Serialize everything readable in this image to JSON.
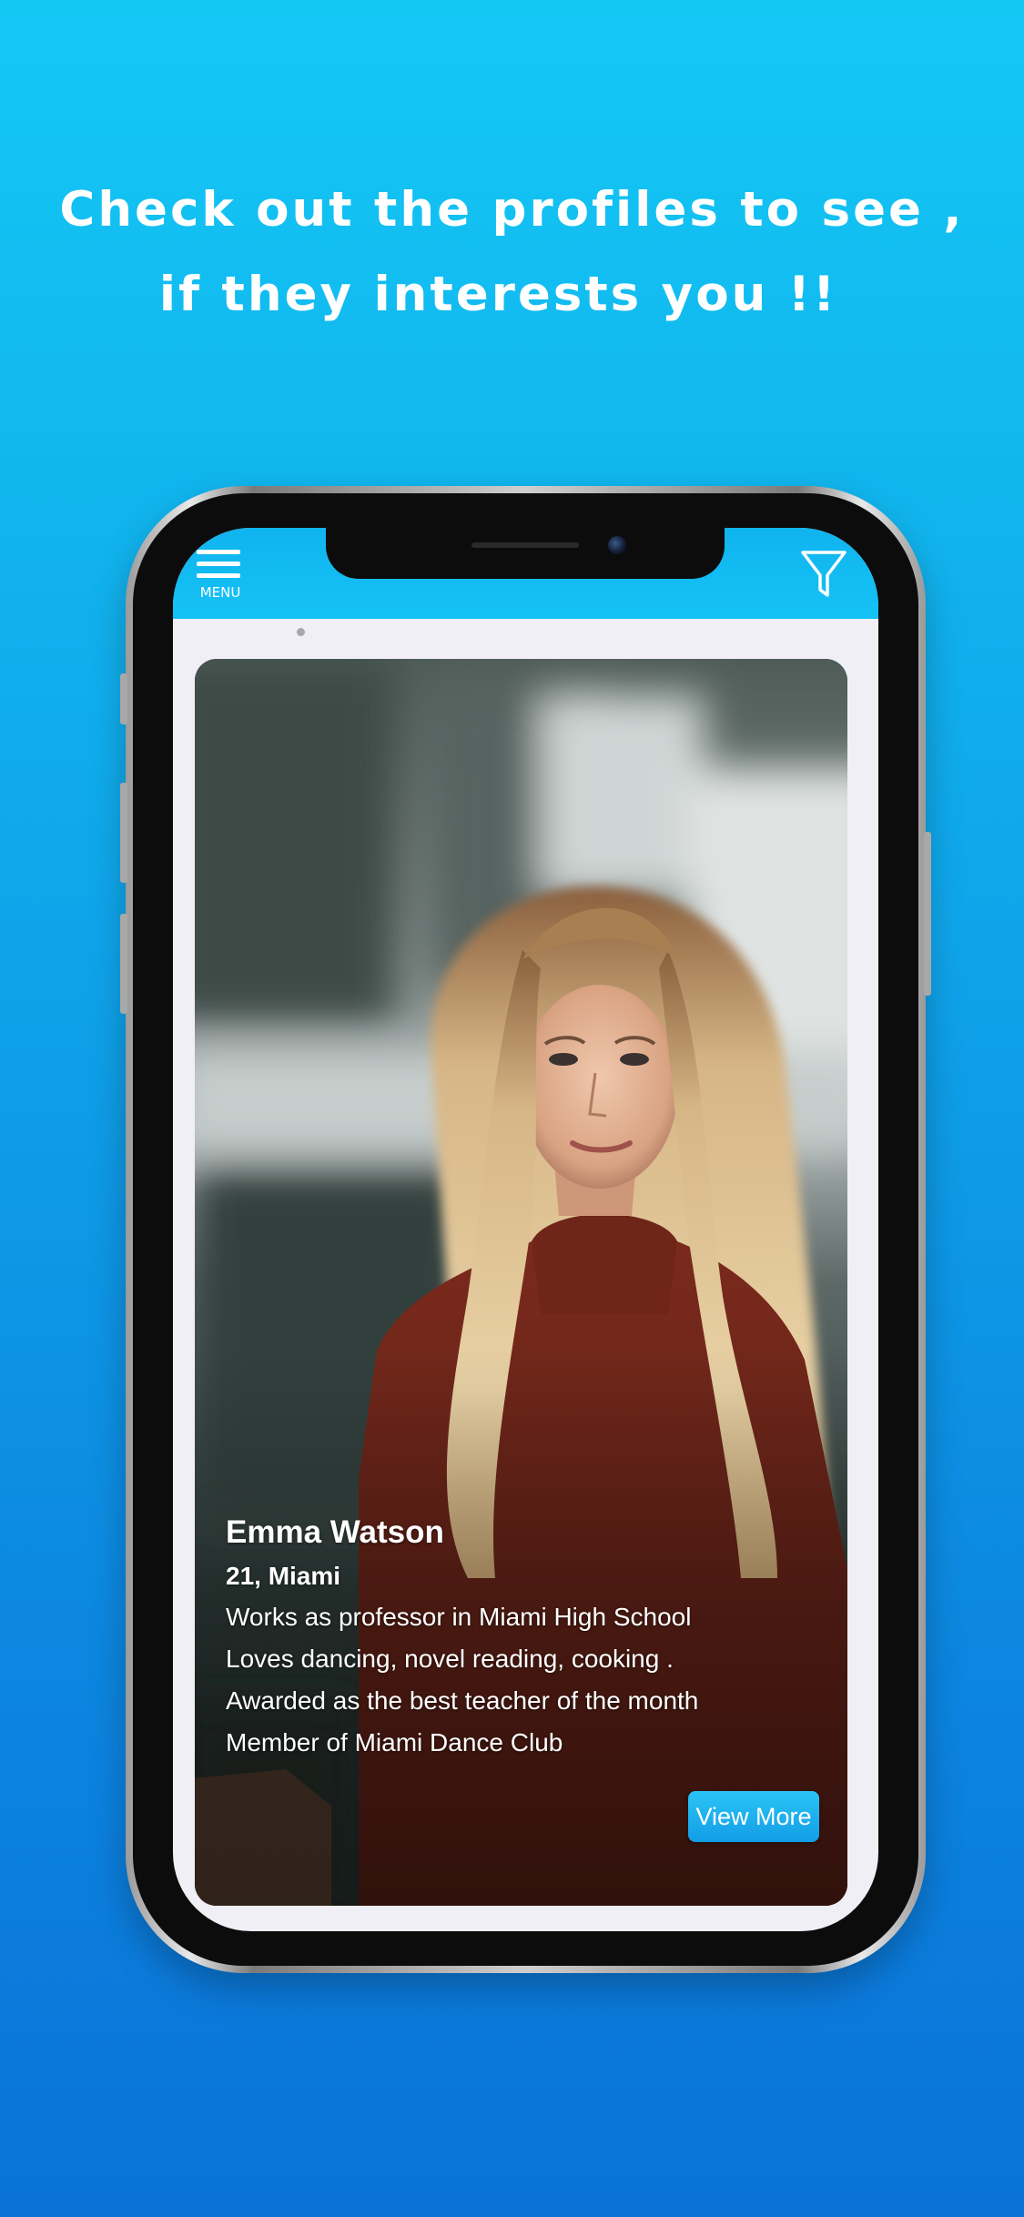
{
  "promo": {
    "line1": "Check out the profiles to see ,",
    "line2": "if they interests you !!"
  },
  "header": {
    "menu_label": "MENU",
    "menu_icon": "hamburger-menu-icon",
    "filter_icon": "funnel-filter-icon",
    "accent_color": "#15c2f5"
  },
  "profile": {
    "name": "Emma Watson",
    "age_location": "21, Miami",
    "details": [
      "Works as professor in Miami High School",
      "Loves dancing, novel reading, cooking .",
      "Awarded as the best teacher of the month",
      "Member of Miami Dance Club"
    ],
    "view_more_label": "View More"
  }
}
